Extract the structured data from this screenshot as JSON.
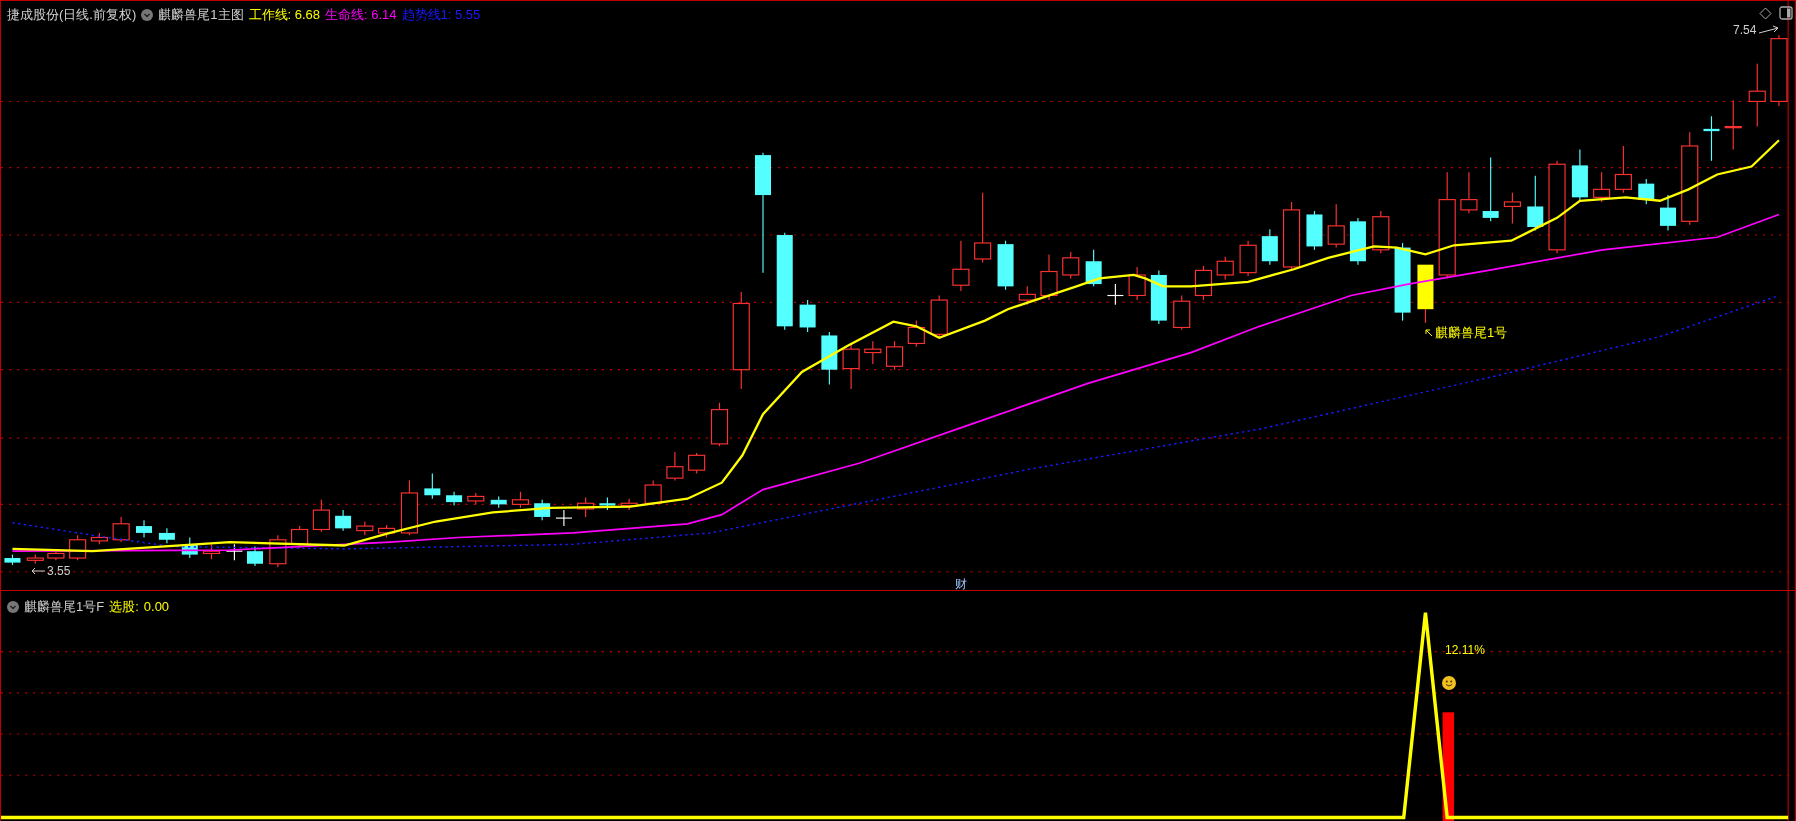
{
  "main_panel": {
    "stock_title": "捷成股份(日线.前复权)",
    "indicator_title": "麒麟兽尾1主图",
    "lines": [
      {
        "text": "工作线: 6.68",
        "color": "#ffff00"
      },
      {
        "text": "生命线: 6.14",
        "color": "#ff00ff"
      },
      {
        "text": "趋势线1: 5.55",
        "color": "#1a1aff"
      }
    ],
    "high_label": "7.54",
    "low_label": "3.55",
    "signal_label": "麒麟兽尾1号",
    "axis_mark": "财"
  },
  "sub_panel": {
    "indicator_title": "麒麟兽尾1号F",
    "value_label": "选股:",
    "value": "0.00",
    "gain_label": "12.11%"
  }
}
